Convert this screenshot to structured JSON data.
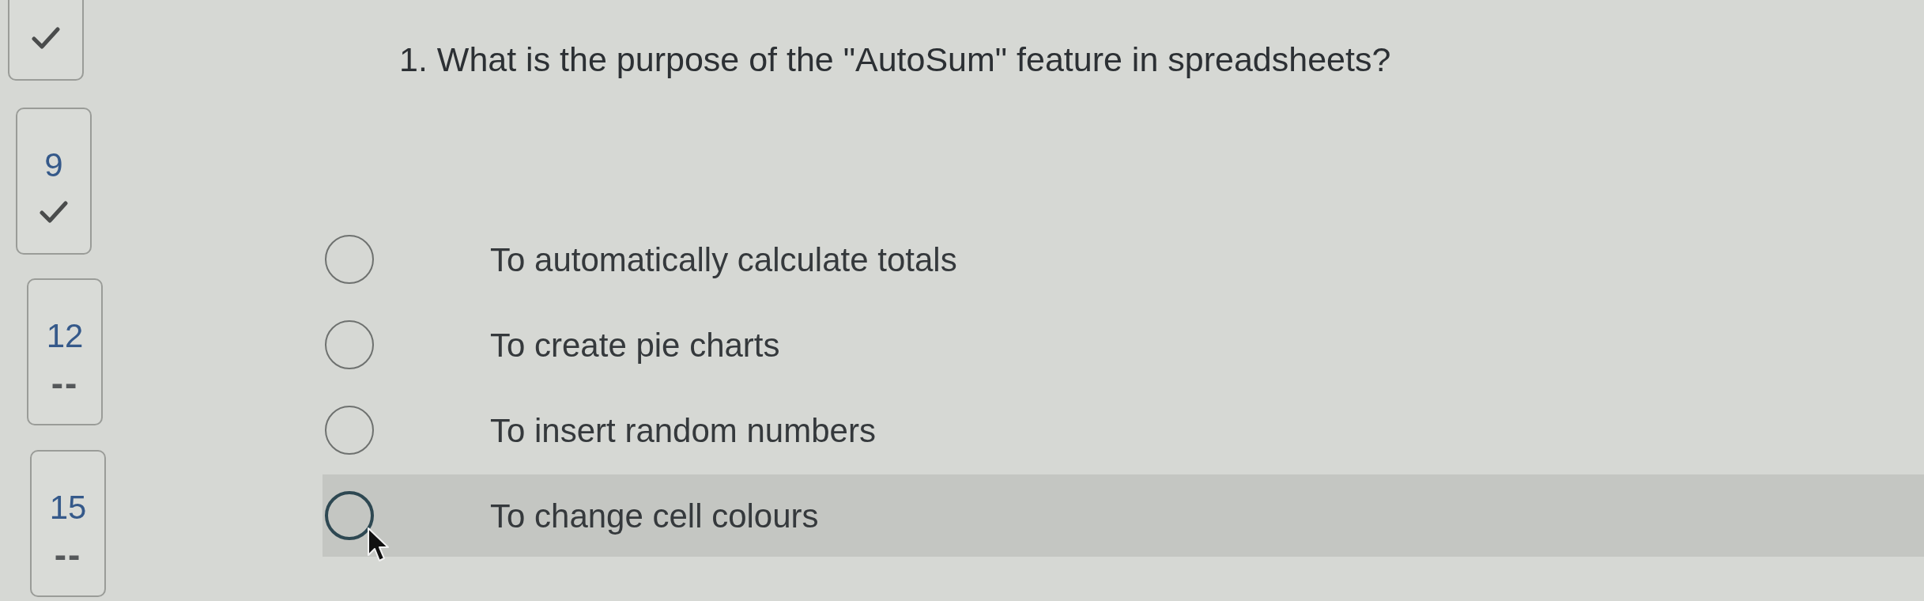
{
  "sidebar": {
    "questions": [
      {
        "kind": "answered"
      },
      {
        "number": "9",
        "kind": "answered"
      },
      {
        "number": "12",
        "kind": "unanswered",
        "mark": "--"
      },
      {
        "number": "15",
        "kind": "unanswered",
        "mark": "--"
      }
    ]
  },
  "question": {
    "text": "1. What is the purpose of the \"AutoSum\" feature in spreadsheets?",
    "options": [
      {
        "label": "To automatically calculate totals",
        "selected": false,
        "hovered": false
      },
      {
        "label": "To create pie charts",
        "selected": false,
        "hovered": false
      },
      {
        "label": "To insert random numbers",
        "selected": false,
        "hovered": false
      },
      {
        "label": "To change cell colours",
        "selected": false,
        "hovered": true
      }
    ]
  }
}
